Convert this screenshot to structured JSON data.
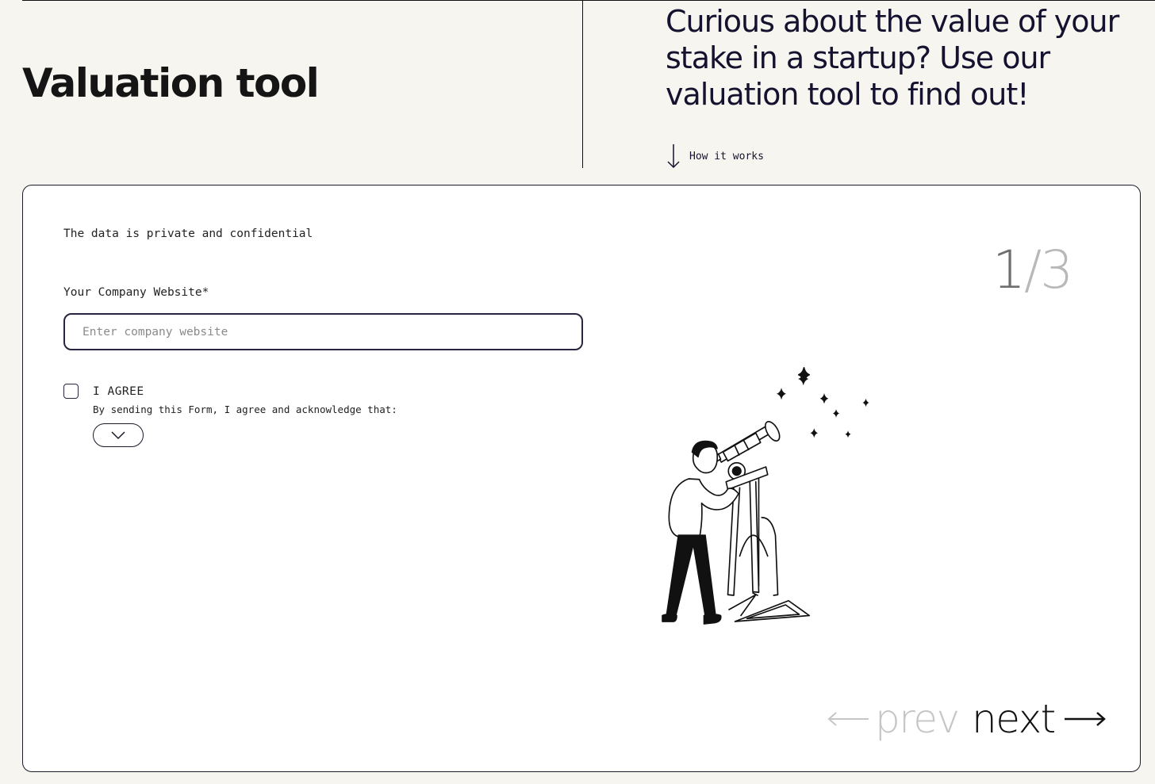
{
  "header": {
    "title": "Valuation tool",
    "tagline": "Curious about the value of your stake in a startup? Use our valuation tool to find out!",
    "how_it_works": "How it works"
  },
  "form": {
    "privacy_note": "The data is private and confidential",
    "website_label": "Your Company Website*",
    "website_placeholder": "Enter company website",
    "website_value": "",
    "agree_label": "I AGREE",
    "agree_checked": false,
    "agree_description": "By sending this Form, I agree and acknowledge that:"
  },
  "stepper": {
    "current": "1",
    "separator": "/",
    "total": "3"
  },
  "navigation": {
    "prev_label": "prev",
    "next_label": "next",
    "prev_enabled": false
  },
  "icons": {
    "how_it_works": "arrow-down-icon",
    "expand": "chevron-down-icon",
    "prev": "arrow-left-icon",
    "next": "arrow-right-icon",
    "illustration": "telescope-illustration"
  },
  "colors": {
    "background": "#f6f5ef",
    "card": "#ffffff",
    "ink": "#14122e",
    "disabled": "#c6c6c6"
  }
}
